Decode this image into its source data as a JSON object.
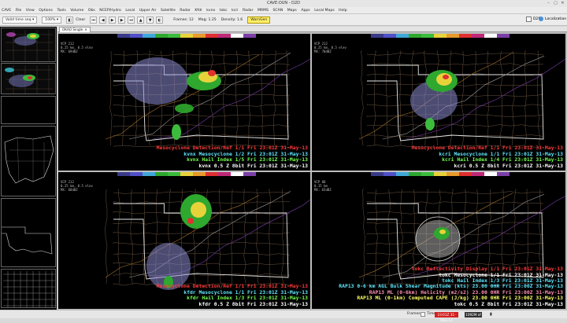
{
  "window": {
    "title": "CAVE:OUN - D2D"
  },
  "menu": [
    "CAVE",
    "File",
    "View",
    "Options",
    "Tools",
    "Volume",
    "Obs",
    "NCEP/Hydro",
    "Local",
    "Upper Air",
    "Satellite",
    "Radar",
    "Kfdr",
    "kvnx",
    "tokc",
    "kcri",
    "Radar",
    "MRMS",
    "SCAN",
    "Maps",
    "Apps",
    "Local Maps",
    "Help"
  ],
  "toolbar": {
    "time_select": "Valid time seq",
    "zoom": "100%",
    "clear": "Clear",
    "frames_label": "Frames: 12",
    "map_label": "Mag: 1.25",
    "density_label": "Density: 1.6",
    "warngen": "WarnGen",
    "perspective": "D2D",
    "localization": "Localization"
  },
  "tab": {
    "label": "OKAO Single"
  },
  "panes": [
    {
      "info": [
        "VCP 212",
        "0.25 km, 0.5 elev",
        "MX: 69dBZ"
      ],
      "legend": [
        {
          "text": "Mesocyclone Detection/Ref 1/1  Fri 23:01Z 31-May-13",
          "color": "red"
        },
        {
          "text": "kvnx Mesocyclone 1/2  Fri 23:01Z 31-May-13",
          "color": "cyan"
        },
        {
          "text": "kvnx Hail Index 1/5  Fri 23:01Z 31-May-13",
          "color": "green"
        },
        {
          "text": "kvnx 0.5  Z 8bit  Fri 23:01Z 31-May-13",
          "color": "white"
        }
      ]
    },
    {
      "info": [
        "VCP 212",
        "0.25 km, 0.5 elev",
        "MX: 70dBZ"
      ],
      "legend": [
        {
          "text": "Mesocyclone Detection/Ref 1/1  Fri 23:01Z 31-May-13",
          "color": "red"
        },
        {
          "text": "kcri Mesocyclone 1/1  Fri 23:01Z 31-May-13",
          "color": "cyan"
        },
        {
          "text": "kcri Hail Index 1/4  Fri 23:01Z 31-May-13",
          "color": "green"
        },
        {
          "text": "kcri 0.5  Z 8bit  Fri 23:01Z 31-May-13",
          "color": "white"
        }
      ]
    },
    {
      "info": [
        "VCP 212",
        "0.25 km, 0.5 elev",
        "MX: 68dBZ"
      ],
      "legend": [
        {
          "text": "Mesocyclone Detection/Ref 1/1  Fri 23:01Z 31-May-13",
          "color": "red"
        },
        {
          "text": "kfdr Mesocyclone 1/1  Fri 23:01Z 31-May-13",
          "color": "cyan"
        },
        {
          "text": "kfdr Hail Index 1/3  Fri 23:01Z 31-May-13",
          "color": "green"
        },
        {
          "text": "kfdr 0.5  Z 8bit  Fri 23:01Z 31-May-13",
          "color": "white"
        }
      ]
    },
    {
      "info": [
        "VCP 80",
        "0.15 km",
        "MX: 65dBZ"
      ],
      "legend": [
        {
          "text": "tokc Reflectivity Display 1/1  Fri 23:01Z 31-May-13",
          "color": "red"
        },
        {
          "text": "tokc Mesocyclone 1/1  Fri 23:01Z 31-May-13",
          "color": "white"
        },
        {
          "text": "tokc Hail Index 1/3  Fri 23:01Z 31-May-13",
          "color": "cyan"
        },
        {
          "text": "RAP13 0-6 km AGL Bulk Shear Magnitude (kts)   23.00  0HR Fri 23:00Z 31-May-13",
          "color": "cyan"
        },
        {
          "text": "RAP13 ML (0-6km) Helicity (m2/s2)   23.00  0HR Fri 23:00Z 31-May-13",
          "color": "pink"
        },
        {
          "text": "RAP13 ML (0-1km) Computed CAPE (J/kg)   23.00  0HR Fri 23:00Z 31-May-13",
          "color": "yellow"
        },
        {
          "text": "tokc 0.5  Z 8bit  Fri 23:01Z 31-May-13",
          "color": "white"
        }
      ]
    }
  ],
  "statusbar": {
    "frames_label": "Frames",
    "time_label": "Time:",
    "time_value": "23:01Z 31-May-13",
    "memory": "1092M of"
  },
  "colors": {
    "accent": "#ffee66",
    "time_box": "#d32020"
  }
}
